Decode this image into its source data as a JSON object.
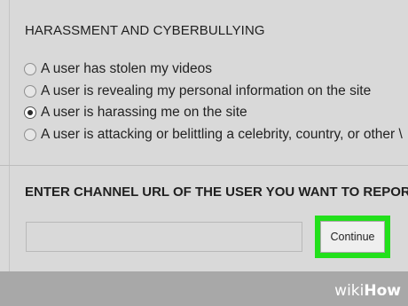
{
  "report": {
    "section_title": "HARASSMENT AND CYBERBULLYING",
    "options": [
      {
        "label": "A user has stolen my videos",
        "checked": false
      },
      {
        "label": "A user is revealing my personal information on the site",
        "checked": false
      },
      {
        "label": "A user is harassing me on the site",
        "checked": true
      },
      {
        "label": "A user is attacking or belittling a celebrity, country, or other \\",
        "checked": false
      }
    ]
  },
  "url_section": {
    "title": "ENTER CHANNEL URL OF THE USER YOU WANT TO REPORT:",
    "input_value": "",
    "input_placeholder": ""
  },
  "actions": {
    "continue_label": "Continue"
  },
  "highlight_color": "#22e01b",
  "watermark": {
    "prefix": "wiki",
    "suffix": "How"
  }
}
